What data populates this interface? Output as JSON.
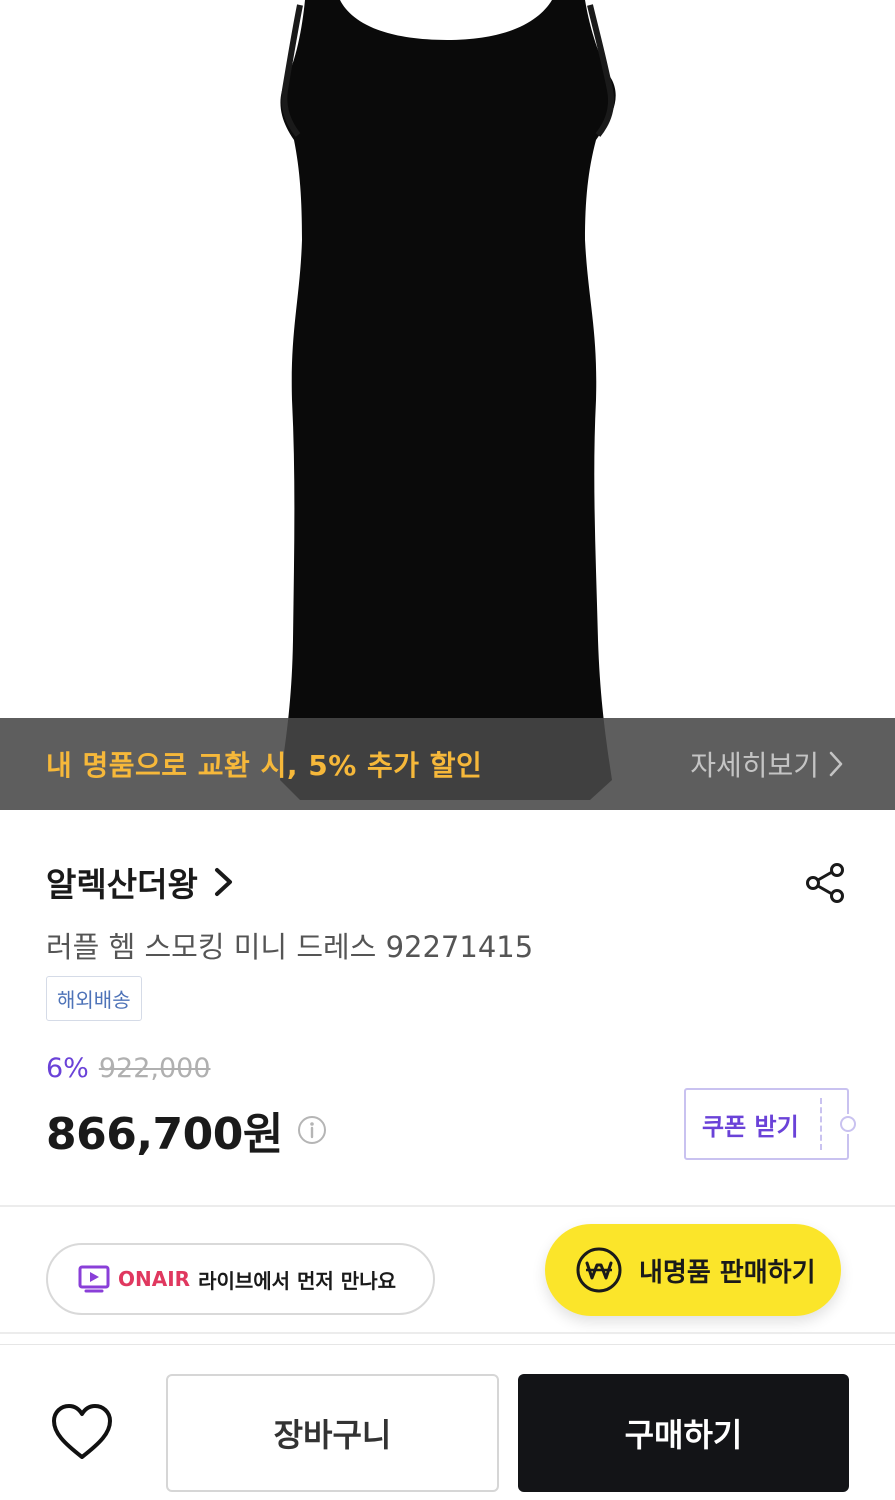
{
  "promo_banner": {
    "text": "내 명품으로 교환 시, 5% 추가 할인",
    "more_label": "자세히보기",
    "text_color": "#f6b83a"
  },
  "product": {
    "brand": "알렉산더왕",
    "title": "러플 헴 스모킹 미니 드레스 92271415",
    "badge": "해외배송",
    "discount_rate": "6%",
    "original_price": "922,000",
    "sale_price": "866,700원",
    "image_alt": "black ruffle hem smocked mini dress"
  },
  "coupon": {
    "label": "쿠폰 받기"
  },
  "live": {
    "onair_label": "ONAIR",
    "text": "라이브에서 먼저 만나요"
  },
  "sell_fab": {
    "label": "내명품 판매하기",
    "color": "#fbe52a"
  },
  "bottom_bar": {
    "cart_label": "장바구니",
    "buy_label": "구매하기"
  },
  "icons": {
    "share": "share-icon",
    "info": "info-icon",
    "heart": "heart-icon",
    "won": "won-icon",
    "onair": "onair-play-icon",
    "chevron": "chevron-right-icon"
  },
  "colors": {
    "accent_purple": "#6a42d8",
    "onair_red": "#e0385f",
    "buy_button": "#131417"
  }
}
